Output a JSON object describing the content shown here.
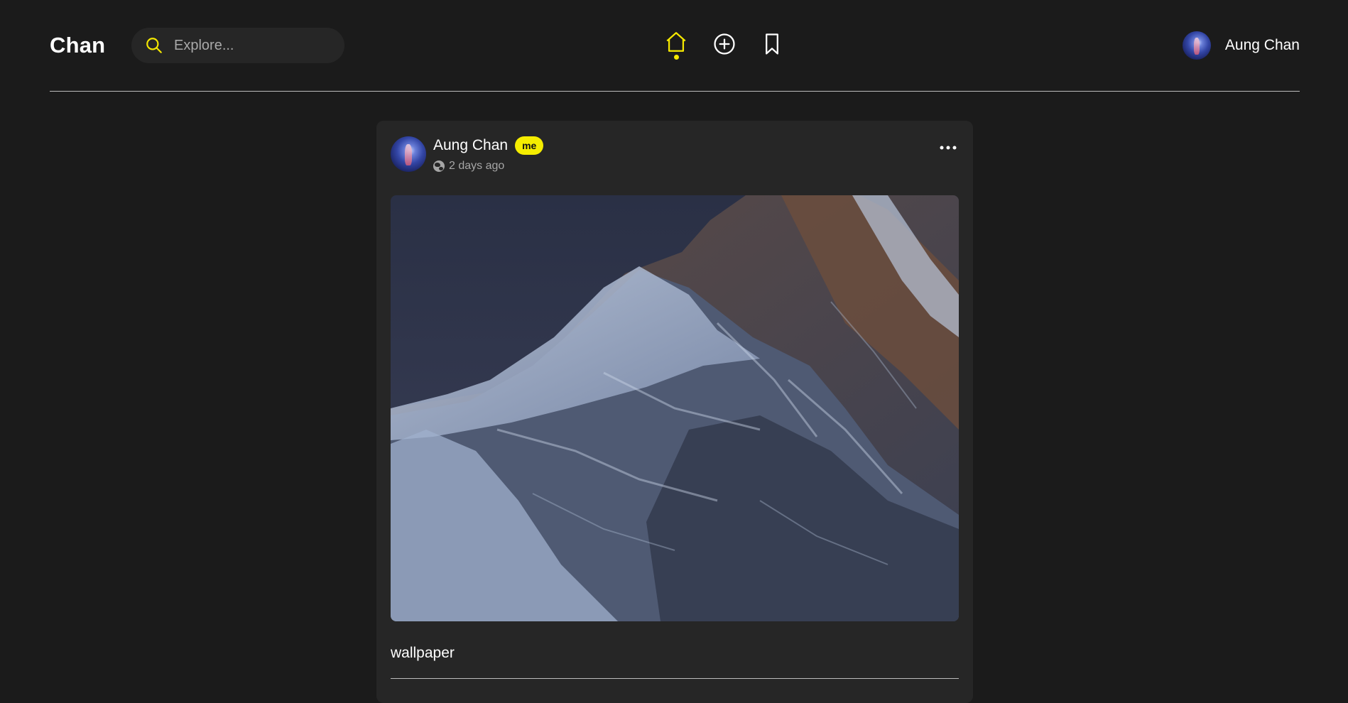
{
  "header": {
    "brand": "Chan",
    "search": {
      "placeholder": "Explore...",
      "value": "",
      "icon": "search-icon"
    },
    "nav": [
      {
        "icon": "home-icon",
        "active": true
      },
      {
        "icon": "plus-circle-icon",
        "active": false
      },
      {
        "icon": "bookmark-icon",
        "active": false
      }
    ],
    "user": {
      "name": "Aung Chan"
    }
  },
  "post": {
    "author": "Aung Chan",
    "badge": "me",
    "time": "2 days ago",
    "visibility_icon": "globe-icon",
    "menu_icon": "more-horizontal-icon",
    "image": "snowy mountain peak wallpaper",
    "caption": "wallpaper"
  },
  "colors": {
    "background": "#1b1b1b",
    "card": "#262626",
    "accent": "#f5e800",
    "muted_text": "#a6a6a6"
  }
}
